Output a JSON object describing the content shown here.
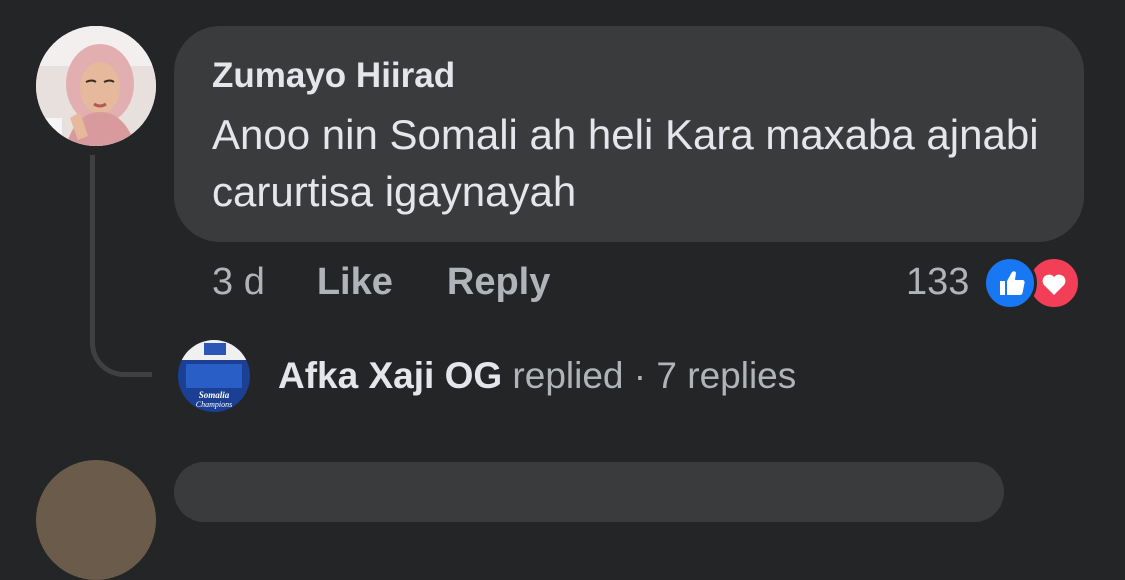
{
  "comment": {
    "author": "Zumayo Hiirad",
    "text": "Anoo nin Somali ah heli Kara maxaba ajnabi carurtisa igaynayah",
    "time": "3 d",
    "like_label": "Like",
    "reply_label": "Reply",
    "reaction_count": "133",
    "reactions": [
      "like-icon",
      "love-icon"
    ]
  },
  "reply_summary": {
    "author": "Afka Xaji OG",
    "verb": "replied",
    "separator": "·",
    "count_text": "7 replies",
    "avatar_text_1": "Somalia",
    "avatar_text_2": "Champions"
  },
  "colors": {
    "background": "#242526",
    "bubble": "#3a3b3c",
    "primary_text": "#e4e6eb",
    "secondary_text": "#b0b3b8",
    "like_blue": "#1877f2",
    "love_red": "#f33e58"
  }
}
